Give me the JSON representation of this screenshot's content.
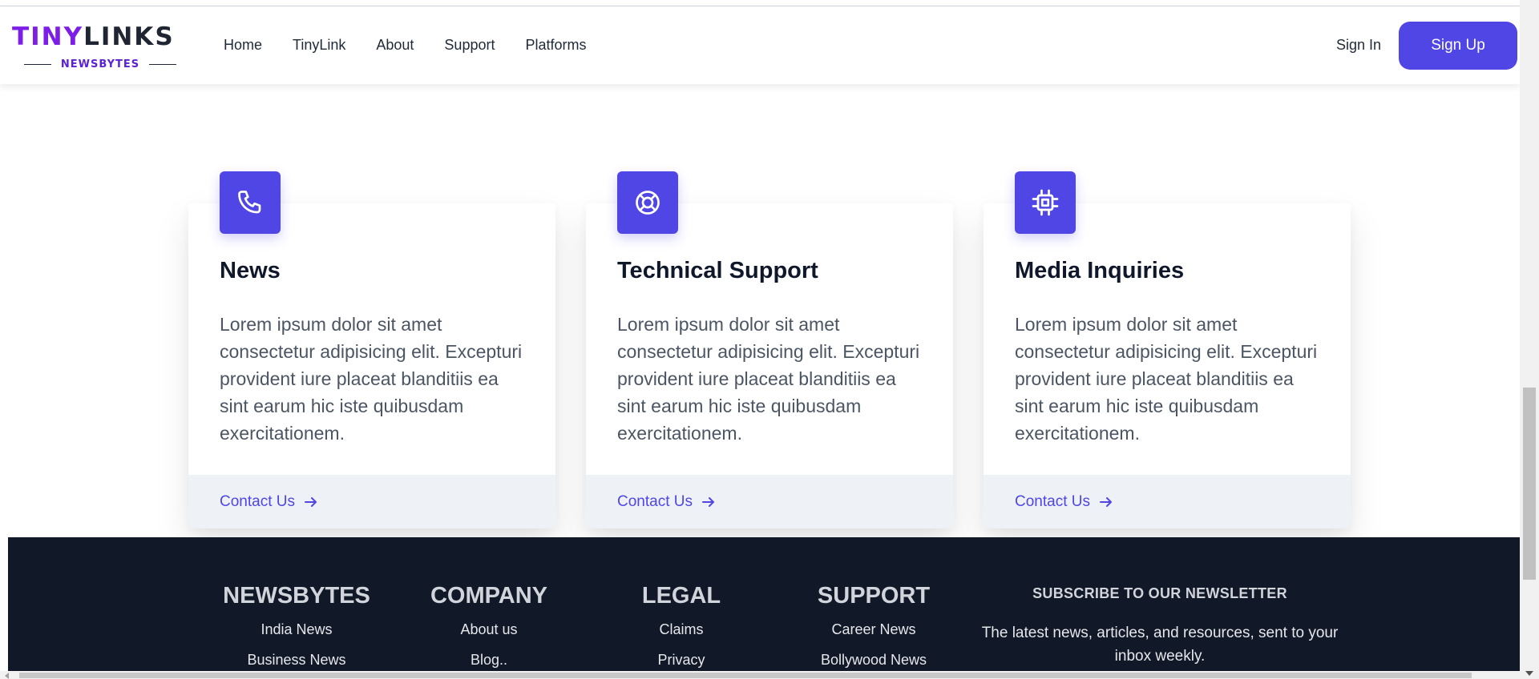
{
  "brand": {
    "logo_tiny": "TINY",
    "logo_links": "LINKS",
    "logo_sub": "NEWSBYTES"
  },
  "nav": {
    "items": [
      {
        "label": "Home"
      },
      {
        "label": "TinyLink"
      },
      {
        "label": "About"
      },
      {
        "label": "Support"
      },
      {
        "label": "Platforms"
      }
    ],
    "signin_label": "Sign In",
    "signup_label": "Sign Up"
  },
  "cards": [
    {
      "icon": "phone-icon",
      "title": "News",
      "body": "Lorem ipsum dolor sit amet consectetur adipisicing elit. Excepturi provident iure placeat blanditiis ea sint earum hic iste quibusdam exercitationem.",
      "link": "Contact Us"
    },
    {
      "icon": "lifebuoy-icon",
      "title": "Technical Support",
      "body": "Lorem ipsum dolor sit amet consectetur adipisicing elit. Excepturi provident iure placeat blanditiis ea sint earum hic iste quibusdam exercitationem.",
      "link": "Contact Us"
    },
    {
      "icon": "chip-icon",
      "title": "Media Inquiries",
      "body": "Lorem ipsum dolor sit amet consectetur adipisicing elit. Excepturi provident iure placeat blanditiis ea sint earum hic iste quibusdam exercitationem.",
      "link": "Contact Us"
    }
  ],
  "footer": {
    "columns": [
      {
        "title": "NEWSBYTES",
        "links": [
          "India News",
          "Business News"
        ]
      },
      {
        "title": "COMPANY",
        "links": [
          "About us",
          "Blog.."
        ]
      },
      {
        "title": "LEGAL",
        "links": [
          "Claims",
          "Privacy"
        ]
      },
      {
        "title": "SUPPORT",
        "links": [
          "Career News",
          "Bollywood News"
        ]
      }
    ],
    "newsletter_title": "SUBSCRIBE TO OUR NEWSLETTER",
    "newsletter_text": "The latest news, articles, and resources, sent to your inbox weekly."
  },
  "colors": {
    "accent": "#4f46e5",
    "logo_purple": "#7c1ee8",
    "footer_bg": "#111827",
    "card_footer_bg": "#eef2f7"
  }
}
